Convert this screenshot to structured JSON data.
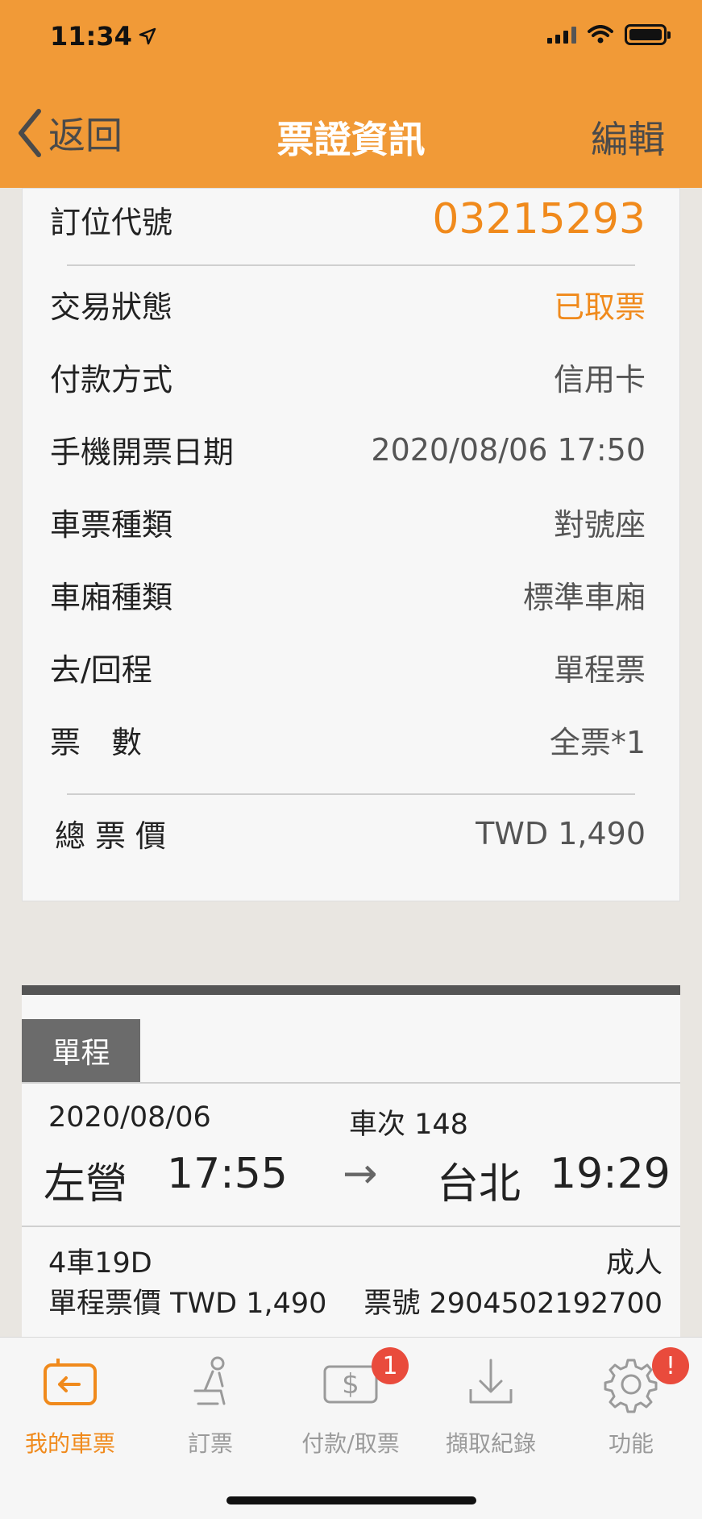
{
  "status_bar": {
    "time": "11:34"
  },
  "nav": {
    "back_label": "返回",
    "title": "票證資訊",
    "edit_label": "編輯"
  },
  "info": {
    "booking_code_label": "訂位代號",
    "booking_code": "03215293",
    "rows": [
      {
        "label": "交易狀態",
        "value": "已取票"
      },
      {
        "label": "付款方式",
        "value": "信用卡"
      },
      {
        "label": "手機開票日期",
        "value": "2020/08/06 17:50"
      },
      {
        "label": "車票種類",
        "value": "對號座"
      },
      {
        "label": "車廂種類",
        "value": "標準車廂"
      },
      {
        "label": "去/回程",
        "value": "單程票"
      },
      {
        "label": "票　數",
        "value": "全票*1"
      }
    ],
    "total_label": "總票價",
    "total_value": "TWD 1,490"
  },
  "journey": {
    "tab_label": "單程",
    "date": "2020/08/06",
    "train_no": "車次 148",
    "from_station": "左營",
    "depart_time": "17:55",
    "arrow": "→",
    "to_station": "台北",
    "arrive_time": "19:29",
    "seat": "4車19D",
    "passenger_type": "成人",
    "fare": "單程票價 TWD 1,490",
    "ticket_no": "票號 2904502192700"
  },
  "tabbar": {
    "items": [
      {
        "label": "我的車票",
        "icon": "my-ticket-icon",
        "active": true
      },
      {
        "label": "訂票",
        "icon": "seat-icon"
      },
      {
        "label": "付款/取票",
        "icon": "payment-icon",
        "badge": "1"
      },
      {
        "label": "擷取紀錄",
        "icon": "download-icon"
      },
      {
        "label": "功能",
        "icon": "gear-icon",
        "badge": "!"
      }
    ]
  },
  "colors": {
    "accent": "#f19a37",
    "highlight": "#f08a1c",
    "badge": "#e94b3c"
  }
}
